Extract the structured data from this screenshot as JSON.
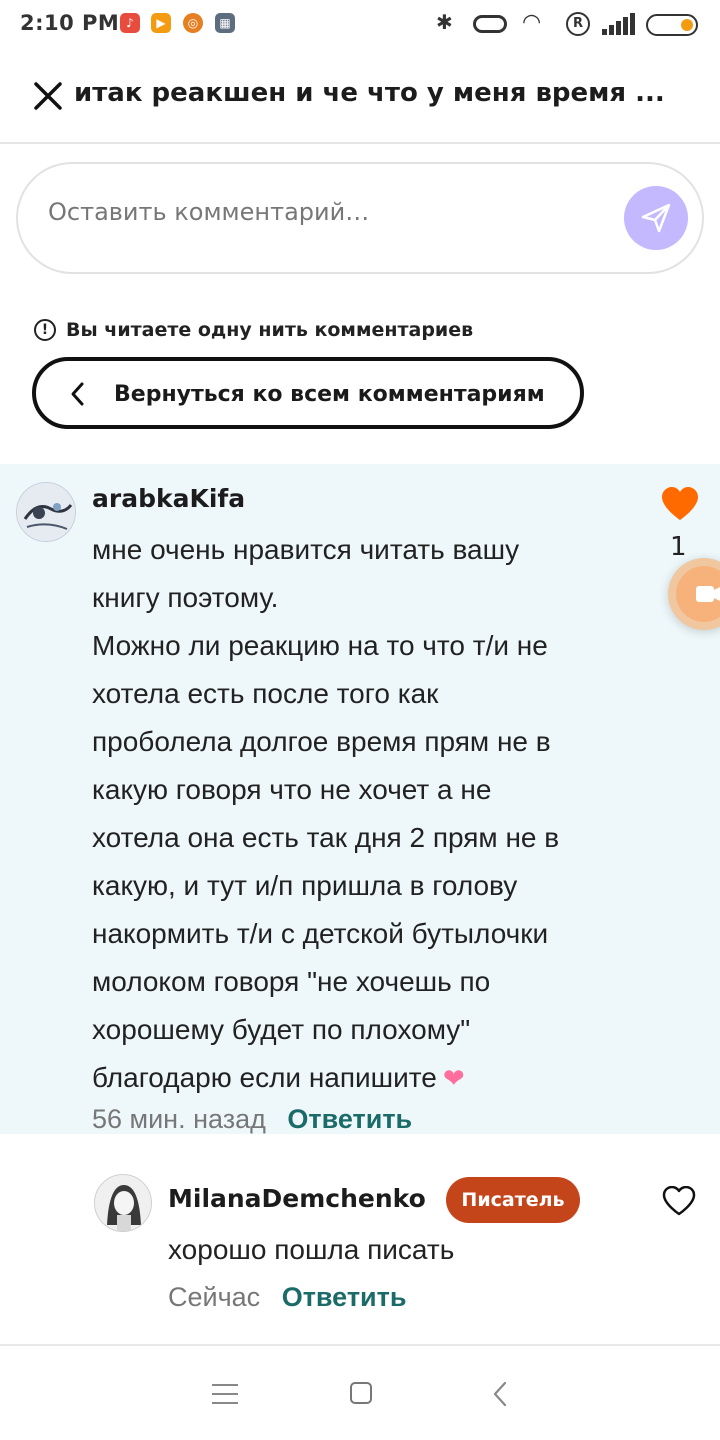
{
  "status_bar": {
    "time": "2:10 PM"
  },
  "header": {
    "title": "итак реакшен и че что у меня время ..."
  },
  "comment_input": {
    "placeholder": "Оставить комментарий…"
  },
  "thread": {
    "notice": "Вы читаете одну нить комментариев",
    "back_label": "Вернуться ко всем комментариям"
  },
  "main_comment": {
    "author": "arabkaKifa",
    "lines": [
      "мне очень нравится читать вашу",
      "книгу поэтому.",
      "Можно ли реакцию на то что т/и не",
      "хотела есть после того как",
      "проболела долгое время прям не в",
      "какую говоря что не хочет а не",
      "хотела она есть так дня 2 прям не в",
      "какую, и тут и/п пришла в голову",
      "накормить т/и с детской бутылочки",
      "молоком говоря \"не хочешь по",
      "хорошему будет по плохому\"",
      "благодарю если напишите"
    ],
    "time": "56 мин. назад",
    "reply_label": "Ответить",
    "likes": "1"
  },
  "reply_comment": {
    "author": "MilanaDemchenko",
    "badge": "Писатель",
    "text": "хорошо пошла писать",
    "time": "Сейчас",
    "reply_label": "Ответить"
  },
  "colors": {
    "accent_teal": "#1b6b68",
    "writer_badge": "#c5451b",
    "heart": "#ff6a00",
    "send_button": "#c4b8ff",
    "thread_background": "#eef8fb"
  },
  "icons": [
    "close-icon",
    "send-icon",
    "info-icon",
    "chevron-left-icon",
    "heart-filled-icon",
    "heart-outline-icon",
    "video-icon"
  ]
}
